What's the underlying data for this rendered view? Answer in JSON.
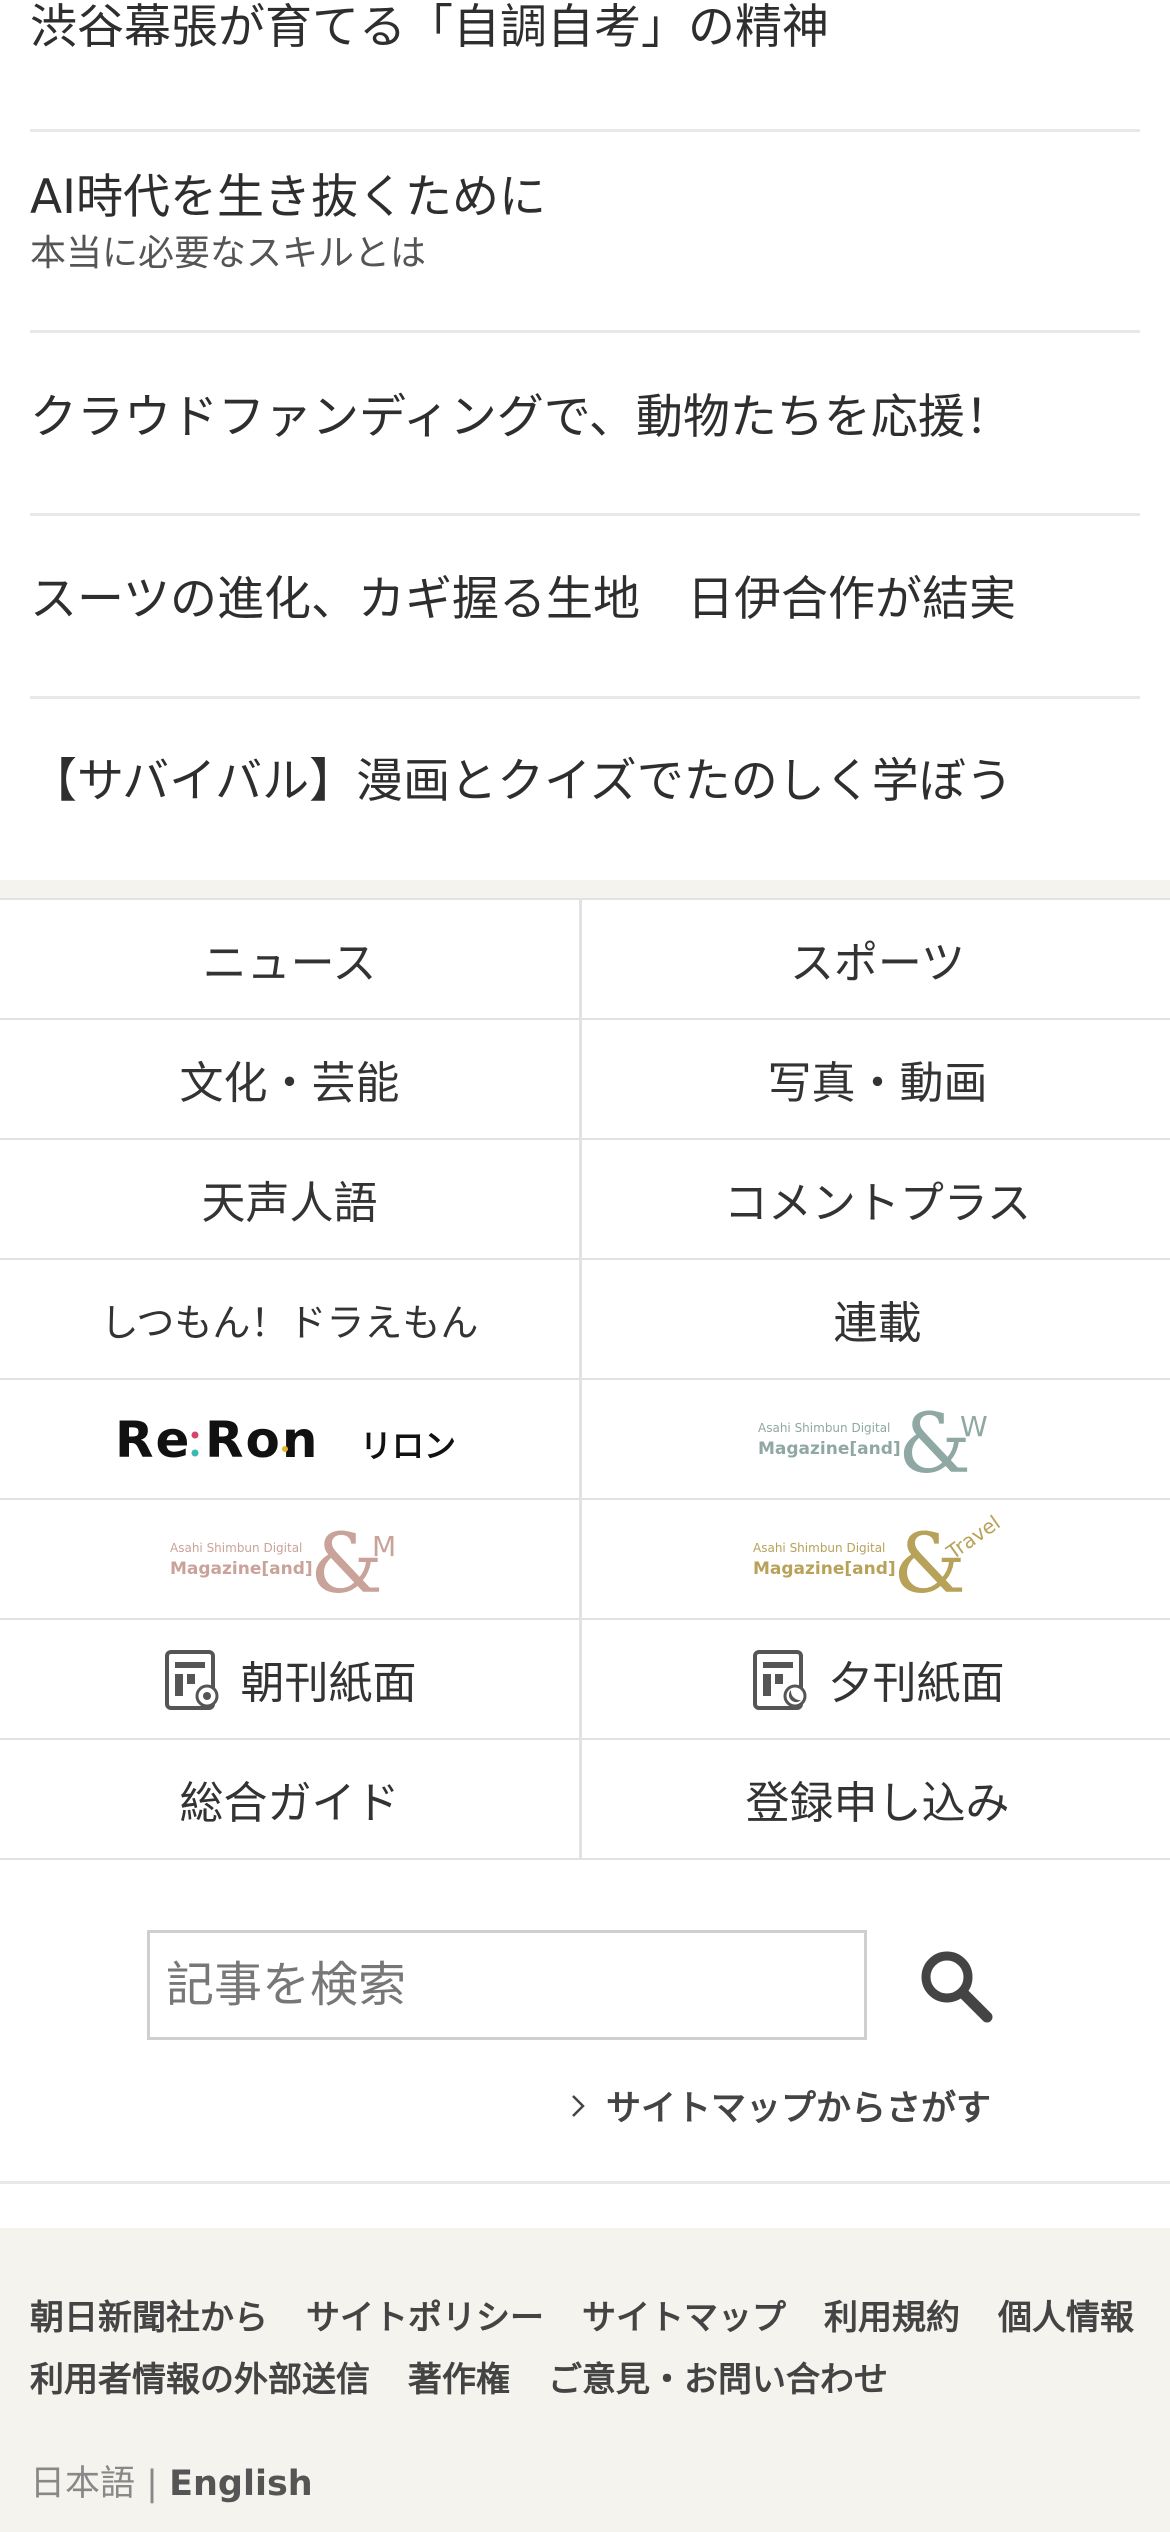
{
  "articles": [
    {
      "title": "渋谷幕張が育てる「自調自考」の精神"
    },
    {
      "title": "AI時代を生き抜くために",
      "subtitle": "本当に必要なスキルとは"
    },
    {
      "title": "クラウドファンディングで、動物たちを応援！"
    },
    {
      "title": "スーツの進化、カギ握る生地　日伊合作が結実"
    },
    {
      "title": "【サバイバル】漫画とクイズでたのしく学ぼう"
    }
  ],
  "nav_grid": {
    "news": "ニュース",
    "sports": "スポーツ",
    "culture": "文化・芸能",
    "photo_video": "写真・動画",
    "tensei_jingo": "天声人語",
    "comment_plus": "コメントプラス",
    "doraemon": "しつもん！ドラえもん",
    "series": "連載",
    "reron_logo": "Re:Ron リロン",
    "and_w_logo": "Asahi Shimbun Digital Magazine[and] &W",
    "and_m_logo": "Asahi Shimbun Digital Magazine[and] &M",
    "and_travel_logo": "Asahi Shimbun Digital Magazine[and] &Travel",
    "morning_paper": "朝刊紙面",
    "evening_paper": "夕刊紙面",
    "guide": "総合ガイド",
    "register": "登録申し込み"
  },
  "search": {
    "placeholder": "記事を検索",
    "sitemap_link": "サイトマップからさがす"
  },
  "footer": {
    "links_row1": [
      "朝日新聞社から",
      "サイトポリシー",
      "サイトマップ",
      "利用規約",
      "個人情報"
    ],
    "links_row2": [
      "利用者情報の外部送信",
      "著作権",
      "ご意見・お問い合わせ"
    ],
    "lang_ja": "日本語",
    "lang_sep": "|",
    "lang_en": "English"
  },
  "colors": {
    "footer_bg": "#f4f3ee",
    "divider": "#e8e8e8",
    "and_w": "#8fa8a3",
    "and_m": "#c9a39a",
    "and_travel": "#b8a25a"
  }
}
